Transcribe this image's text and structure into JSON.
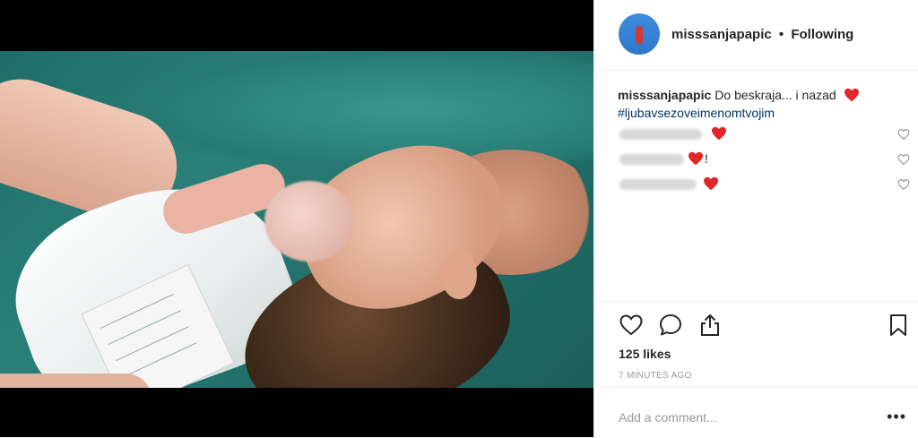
{
  "post": {
    "username": "misssanjapapic",
    "follow_status": "Following",
    "separator": "•",
    "caption_text": "Do beskraja... i nazad",
    "hashtag": "#ljubavsezoveimenomtvojim",
    "comments": [
      {
        "emoji": "red-heart",
        "suffix": ""
      },
      {
        "emoji": "red-heart",
        "suffix": "!"
      },
      {
        "emoji": "red-heart",
        "suffix": ""
      }
    ],
    "likes": "125 likes",
    "time_ago": "7 MINUTES AGO",
    "add_comment_placeholder": "Add a comment...",
    "more_label": "•••"
  },
  "icons": {
    "like": "heart-outline-icon",
    "comment": "speech-bubble-icon",
    "share": "share-icon",
    "save": "bookmark-icon"
  },
  "colors": {
    "text": "#262626",
    "muted": "#999999",
    "hashtag": "#003569",
    "heart": "#e0262b"
  }
}
